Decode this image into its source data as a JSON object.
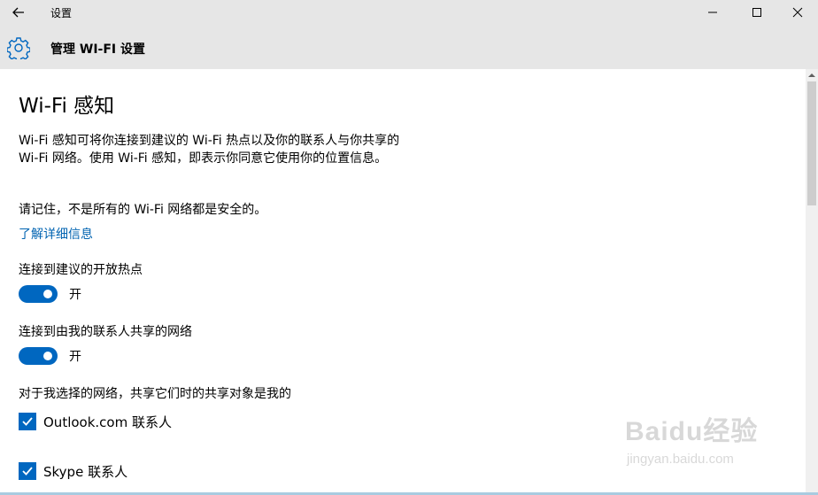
{
  "window": {
    "title": "设置"
  },
  "header": {
    "title": "管理 WI-FI 设置",
    "icon": "gear-icon"
  },
  "main": {
    "page_title": "Wi-Fi 感知",
    "description": "Wi-Fi 感知可将你连接到建议的 Wi-Fi 热点以及你的联系人与你共享的 Wi-Fi 网络。使用 Wi-Fi 感知，即表示你同意它使用你的位置信息。",
    "remember": "请记住，不是所有的 Wi-Fi 网络都是安全的。",
    "learn_more": "了解详细信息",
    "settings": [
      {
        "label": "连接到建议的开放热点",
        "state": "开",
        "on": true
      },
      {
        "label": "连接到由我的联系人共享的网络",
        "state": "开",
        "on": true
      }
    ],
    "share_heading": "对于我选择的网络，共享它们时的共享对象是我的",
    "share_options": [
      {
        "label": "Outlook.com 联系人",
        "checked": true
      },
      {
        "label": "Skype 联系人",
        "checked": true
      }
    ]
  },
  "watermark": {
    "logo": "Baidu经验",
    "url": "jingyan.baidu.com"
  },
  "colors": {
    "accent": "#0067c0",
    "link": "#0063b1",
    "chrome": "#e6e6e6"
  }
}
